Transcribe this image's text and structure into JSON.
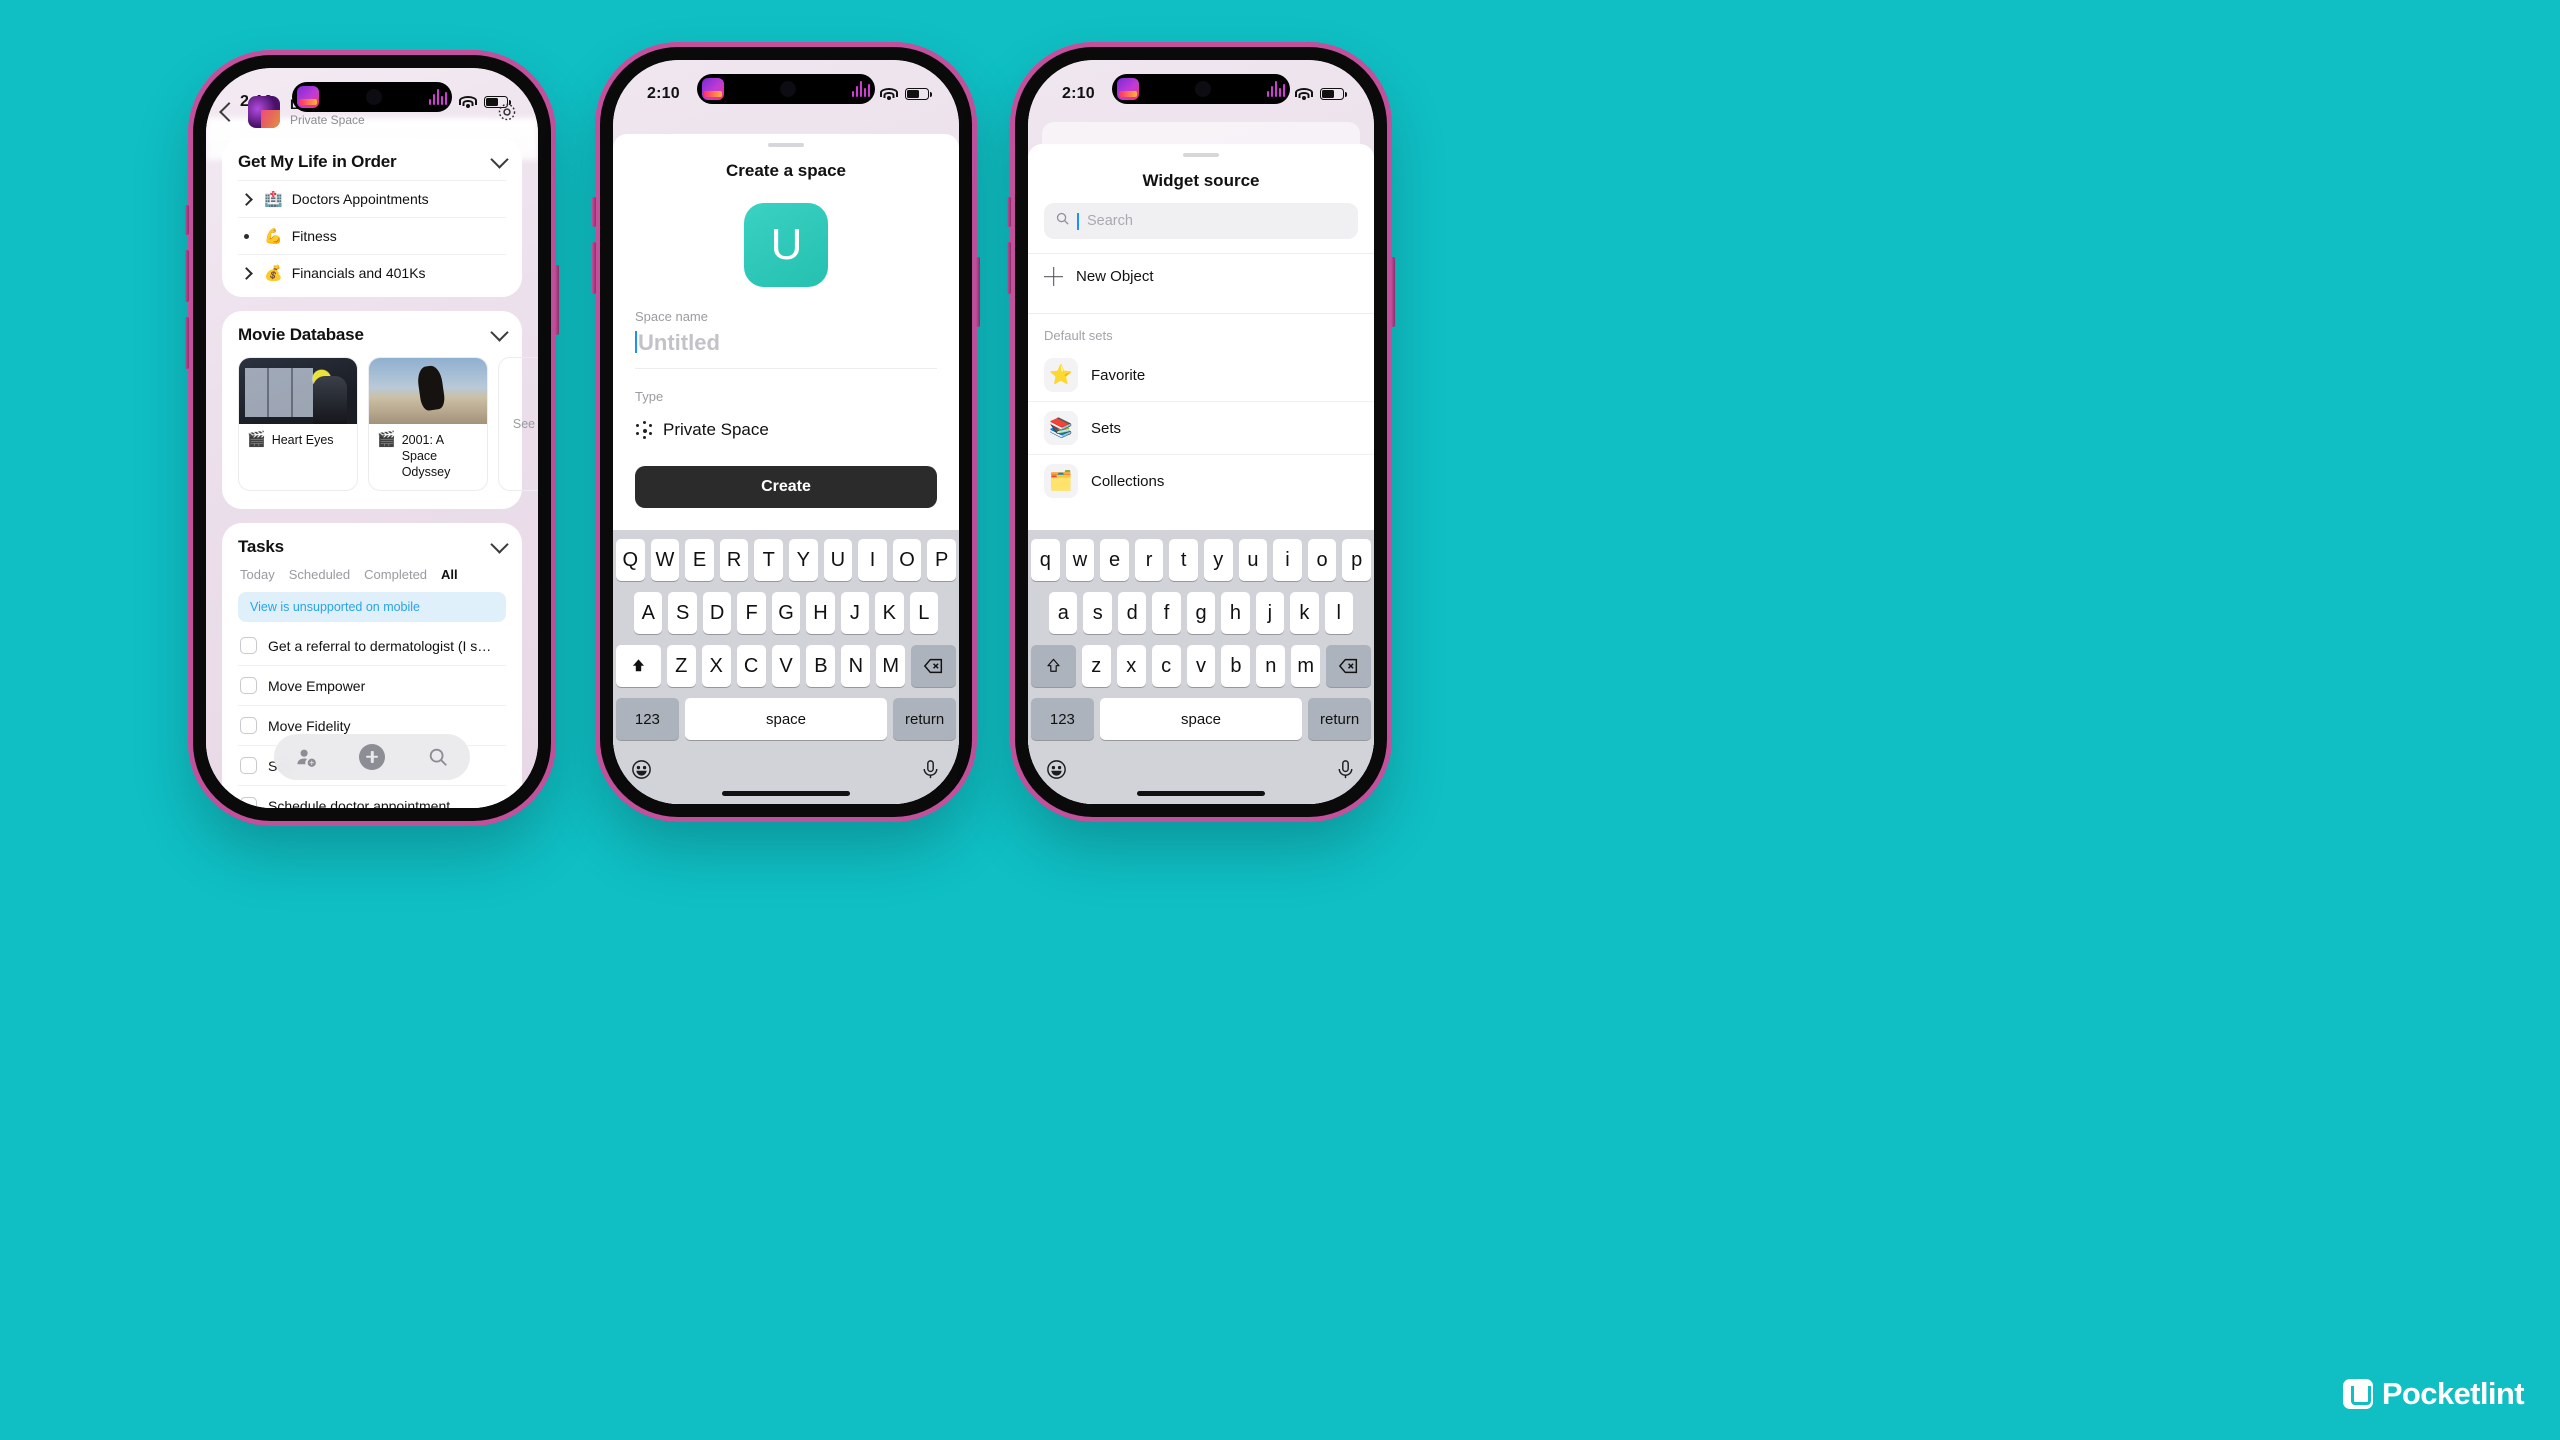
{
  "background_color": "#0FBFC4",
  "watermark": {
    "text": "Pocketlint",
    "icon": "pocket-icon"
  },
  "phones": [
    {
      "id": "phone-space-dashboard",
      "status": {
        "time": "2:10",
        "wifi_icon": "wifi-icon",
        "battery_icon": "battery-icon",
        "island_icon": "live-activity-icon"
      },
      "header": {
        "back_icon": "chevron-left-icon",
        "avatar": "space-avatar",
        "title": "Life",
        "subtitle": "Private Space",
        "settings_icon": "gear-icon"
      },
      "widgets": [
        {
          "title": "Get My Life in Order",
          "collapse_icon": "chevron-down-icon",
          "rows": [
            {
              "marker": "twisty",
              "emoji": "🏥",
              "label": "Doctors Appointments"
            },
            {
              "marker": "dot",
              "emoji": "💪",
              "label": "Fitness"
            },
            {
              "marker": "twisty",
              "emoji": "💰",
              "label": "Financials and 401Ks"
            }
          ]
        },
        {
          "title": "Movie Database",
          "collapse_icon": "chevron-down-icon",
          "cards": [
            {
              "emoji": "🎬",
              "label": "Heart Eyes",
              "thumb": "heart-eyes-poster"
            },
            {
              "emoji": "🎬",
              "label": "2001: A Space Odyssey",
              "thumb": "2001-poster"
            }
          ],
          "see_all_label": "See"
        },
        {
          "title": "Tasks",
          "collapse_icon": "chevron-down-icon",
          "tabs": [
            {
              "label": "Today",
              "active": false
            },
            {
              "label": "Scheduled",
              "active": false
            },
            {
              "label": "Completed",
              "active": false
            },
            {
              "label": "All",
              "active": true
            }
          ],
          "notice": "View is unsupported on mobile",
          "tasks": [
            {
              "label": "Get a referral to dermatologist (I s…",
              "checked": false
            },
            {
              "label": "Move Empower",
              "checked": false
            },
            {
              "label": "Move Fidelity",
              "checked": false
            },
            {
              "label": "Sch…",
              "checked": false
            },
            {
              "label": "Schedule doctor appointment",
              "checked": false
            }
          ]
        }
      ],
      "floating_bar": {
        "share_icon": "add-person-icon",
        "add_icon": "plus-circle-icon",
        "search_icon": "search-icon"
      }
    },
    {
      "id": "phone-create-space",
      "status": {
        "time": "2:10",
        "wifi_icon": "wifi-icon",
        "battery_icon": "battery-icon",
        "island_icon": "live-activity-icon"
      },
      "sheet": {
        "grabber": "sheet-grabber",
        "title": "Create a space",
        "space_icon_letter": "U",
        "space_icon_color": "#2ac6b5",
        "name_field": {
          "label": "Space name",
          "placeholder": "Untitled",
          "value": ""
        },
        "type_field": {
          "label": "Type",
          "icon": "private-space-icon",
          "value": "Private Space"
        },
        "submit_label": "Create"
      },
      "keyboard": {
        "layout": "uppercase",
        "rows": [
          [
            "Q",
            "W",
            "E",
            "R",
            "T",
            "Y",
            "U",
            "I",
            "O",
            "P"
          ],
          [
            "A",
            "S",
            "D",
            "F",
            "G",
            "H",
            "J",
            "K",
            "L"
          ],
          [
            "Z",
            "X",
            "C",
            "V",
            "B",
            "N",
            "M"
          ]
        ],
        "shift_icon": "shift-filled-icon",
        "backspace_icon": "backspace-icon",
        "numbers_label": "123",
        "space_label": "space",
        "return_label": "return",
        "emoji_icon": "emoji-icon",
        "mic_icon": "microphone-icon"
      }
    },
    {
      "id": "phone-widget-source",
      "status": {
        "time": "2:10",
        "wifi_icon": "wifi-icon",
        "battery_icon": "battery-icon",
        "island_icon": "live-activity-icon"
      },
      "sheet": {
        "grabber": "sheet-grabber",
        "title": "Widget source",
        "search": {
          "icon": "search-icon",
          "placeholder": "Search",
          "value": ""
        },
        "new_object": {
          "icon": "plus-icon",
          "label": "New Object"
        },
        "section_label": "Default sets",
        "items": [
          {
            "emoji": "⭐",
            "label": "Favorite"
          },
          {
            "emoji": "📚",
            "label": "Sets"
          },
          {
            "emoji": "🗂️",
            "label": "Collections"
          }
        ]
      },
      "keyboard": {
        "layout": "lowercase",
        "rows": [
          [
            "q",
            "w",
            "e",
            "r",
            "t",
            "y",
            "u",
            "i",
            "o",
            "p"
          ],
          [
            "a",
            "s",
            "d",
            "f",
            "g",
            "h",
            "j",
            "k",
            "l"
          ],
          [
            "z",
            "x",
            "c",
            "v",
            "b",
            "n",
            "m"
          ]
        ],
        "shift_icon": "shift-outline-icon",
        "backspace_icon": "backspace-icon",
        "numbers_label": "123",
        "space_label": "space",
        "return_label": "return",
        "emoji_icon": "emoji-icon",
        "mic_icon": "microphone-icon"
      }
    }
  ]
}
